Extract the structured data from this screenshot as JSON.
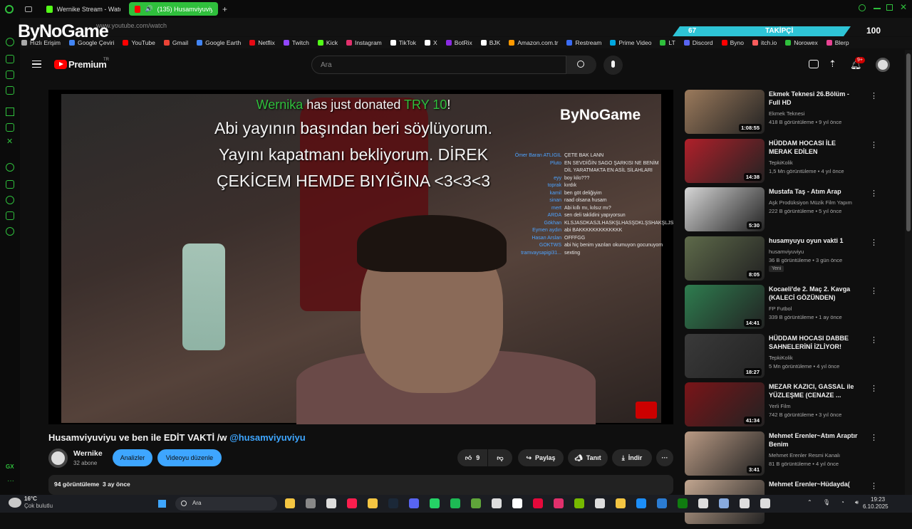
{
  "browser": {
    "tabs": [
      {
        "label": "Wernike Stream - Watch L",
        "active": false
      },
      {
        "label": "(135) Husamviyuviyu...",
        "active": true
      }
    ],
    "address": "www.youtube.com/watch",
    "bookmarks": [
      "Hızlı Erişim",
      "Google Çeviri",
      "YouTube",
      "Gmail",
      "Google Earth",
      "Netflix",
      "Twitch",
      "Kick",
      "Instagram",
      "TikTok",
      "X",
      "BotRix",
      "BJK",
      "Amazon.com.tr",
      "Restream",
      "Prime Video",
      "LT",
      "Discord",
      "Byno",
      "itch.io",
      "Norowex",
      "Blerp"
    ]
  },
  "stream_overlay": {
    "logo": "ByNoGame",
    "followers_count": "67",
    "followers_label": "TAKİPÇİ",
    "counter": "100"
  },
  "youtube": {
    "logo": "Premium",
    "logo_sup": "TR",
    "search_placeholder": "Ara",
    "notif_badge": "9+"
  },
  "video": {
    "donation_name": "Wernika",
    "donation_text": " has just donated ",
    "donation_amount": "TRY 10",
    "donation_end": "!",
    "donation_message": "Abi yayının başından beri söylüyorum. Yayını kapatmanı bekliyorum. DİREK ÇEKİCEM HEMDE BIYIĞINA <3<3<3",
    "in_video_logo": "ByNoGame",
    "chat": [
      {
        "user": "Ömer Baran ATLIGIL",
        "msg": "ÇETE BAK LANN"
      },
      {
        "user": "Pluto",
        "msg": "EN SEVDİĞİN SAGO ŞARKISI NE BENİM DİL YARATMAKTA EN ASİL SİLAHLARI"
      },
      {
        "user": "eyy",
        "msg": "boy kilo???"
      },
      {
        "user": "toprak",
        "msg": "kırdık"
      },
      {
        "user": "kamil",
        "msg": "ben göt deliğiyim"
      },
      {
        "user": "sinan",
        "msg": "raad olsana husam"
      },
      {
        "user": "mert",
        "msg": "Abi kıllı mı, kılsız mı?"
      },
      {
        "user": "ARDA",
        "msg": "sen deli taklidini yapıyorsun"
      },
      {
        "user": "Gökhan",
        "msg": "KLSJASDKASJLHASKŞLHASŞDKLŞSHAKŞLJSHDASDA"
      },
      {
        "user": "Eymen aydın",
        "msg": "abi BAKKKKKKKKKKKKK"
      },
      {
        "user": "Hasan Arslan",
        "msg": "OFFFGG"
      },
      {
        "user": "GOKTWS",
        "msg": "abi hiç benim yazıları okumuyon gocunuyom"
      },
      {
        "user": "tramvaysapigi31...",
        "msg": "sexting"
      }
    ],
    "title_text": "Husamviyuviyu ve ben ile EDİT VAKTİ /w ",
    "title_link": "@husamviyuviyu",
    "channel_name": "Wernike",
    "subscribers": "32 abone",
    "analytics_btn": "Analizler",
    "edit_btn": "Videoyu düzenle",
    "likes": "9",
    "share_btn": "Paylaş",
    "clip_btn": "Tanıt",
    "download_btn": "İndir",
    "views": "94 görüntüleme",
    "age": "3 ay önce"
  },
  "recommendations": [
    {
      "title": "Ekmek Teknesi 26.Bölüm - Full HD",
      "channel": "Ekmek Teknesi",
      "meta": "418 B görüntüleme • 9 yıl önce",
      "duration": "1:08:55",
      "thumb": "#9b7a5c"
    },
    {
      "title": "HÜDDAM HOCASI İLE MERAK EDİLEN KONULARDA SORU ...",
      "channel": "TepkiKolik",
      "meta": "1,5 Mn görüntüleme • 4 yıl önce",
      "duration": "14:38",
      "thumb": "#b0202a"
    },
    {
      "title": "Mustafa Taş - Atım Arap",
      "channel": "Aşk Prodüksiyon Müzik Film Yapım",
      "meta": "222 B görüntüleme • 5 yıl önce",
      "duration": "5:30",
      "thumb": "#d6d6d6"
    },
    {
      "title": "husamyuyu oyun vakti 1",
      "channel": "husamviyuviyu",
      "meta": "36 B görüntüleme • 3 gün önce",
      "duration": "8:05",
      "thumb": "#5e6a4a",
      "badge": "Yeni"
    },
    {
      "title": "Kocaeli'de 2. Maç 2. Kavga (KALECİ GÖZÜNDEN)",
      "channel": "FP Futbol",
      "meta": "339 B görüntüleme • 1 ay önce",
      "duration": "14:41",
      "thumb": "#2e7d4f"
    },
    {
      "title": "HÜDDAM HOCASI DABBE SAHNELERİNİ İZLİYOR!",
      "channel": "TepkiKolik",
      "meta": "5 Mn görüntüleme • 4 yıl önce",
      "duration": "18:27",
      "thumb": "#3a3a3a"
    },
    {
      "title": "MEZAR KAZICI, GASSAL ile YÜZLEŞME (CENAZE ...",
      "channel": "Yerli Film",
      "meta": "742 B görüntüleme • 3 yıl önce",
      "duration": "41:34",
      "thumb": "#7a1418"
    },
    {
      "title": "Mehmet Erenler~Atım Araptır Benim",
      "channel": "Mehmet Erenler Resmi Kanalı",
      "meta": "81 B görüntüleme • 4 yıl önce",
      "duration": "3:41",
      "thumb": "#b99a84"
    },
    {
      "title": "Mehmet Erenler~Hüdayda(",
      "channel": "",
      "meta": "",
      "duration": "",
      "thumb": "#c2a690"
    }
  ],
  "taskbar": {
    "weather_temp": "16°C",
    "weather_desc": "Çok bulutlu",
    "search": "Ara",
    "time": "19:23",
    "date": "6.10.2025"
  },
  "colors": {
    "accent_green": "#2fbf3c",
    "yt_red": "#ff0000",
    "link_blue": "#3ea6ff",
    "follow_cyan": "#2ec4d6"
  }
}
